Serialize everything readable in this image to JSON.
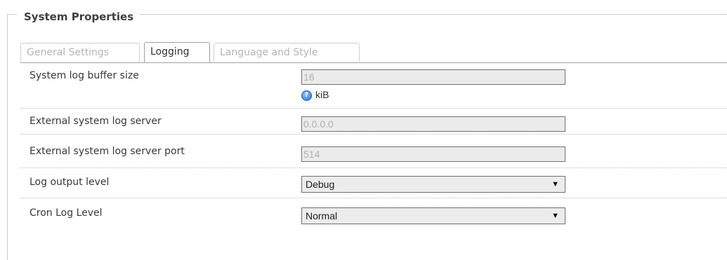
{
  "section": {
    "legend": "System Properties"
  },
  "tabs": [
    {
      "label": "General Settings",
      "active": false
    },
    {
      "label": "Logging",
      "active": true
    },
    {
      "label": "Language and Style",
      "active": false
    }
  ],
  "fields": {
    "buffer_size": {
      "label": "System log buffer size",
      "value": "16",
      "unit": "kiB",
      "help_icon": "question-icon"
    },
    "log_server": {
      "label": "External system log server",
      "value": "0.0.0.0"
    },
    "log_server_port": {
      "label": "External system log server port",
      "value": "514"
    },
    "log_output_level": {
      "label": "Log output level",
      "value": "Debug"
    },
    "cron_log_level": {
      "label": "Cron Log Level",
      "value": "Normal"
    }
  },
  "colors": {
    "accent": "#2a74c8",
    "input_bg": "#ebebeb",
    "border": "#a0a0a0"
  }
}
